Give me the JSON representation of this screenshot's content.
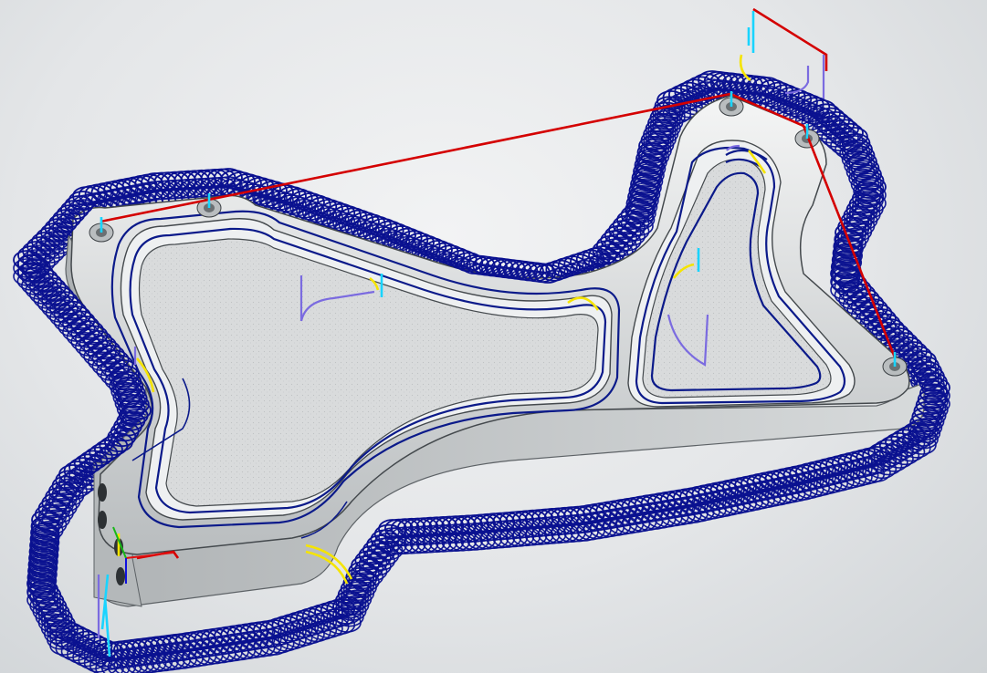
{
  "viewport": {
    "kind": "3d-cam-toolpath-view",
    "background_color": "#e6e8ea"
  },
  "part": {
    "material_color": "#c9cccd",
    "pocket_floor_color": "#d7d9da",
    "outline_color": "#4a4f55",
    "bolt_holes": 5,
    "side_holes": 4
  },
  "toolpaths": {
    "trochoidal_color": "#0a1190",
    "contour_color": "#0b1a8a",
    "rapid_color": "#d40000",
    "lead_in_color": "#f5e400",
    "plunge_color": "#19d4ff",
    "retract_color": "#7b6be0"
  },
  "icons": {
    "triad": "coordinate-axis-triad-icon"
  }
}
